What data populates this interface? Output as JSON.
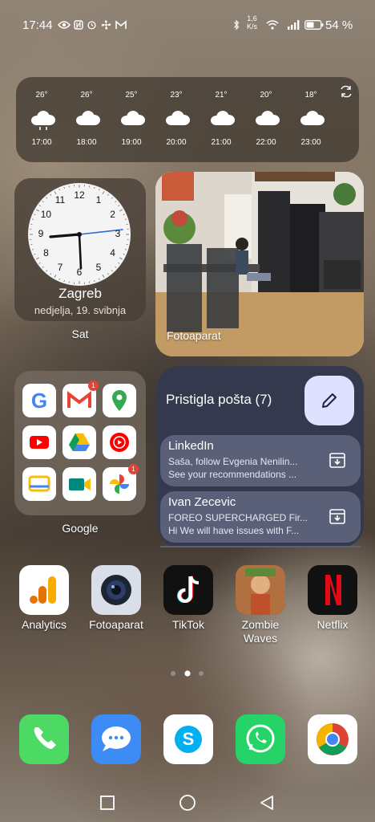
{
  "status": {
    "time": "17:44",
    "net_speed_top": "1,6",
    "net_speed_unit": "K/s",
    "battery": "54 %"
  },
  "weather": {
    "items": [
      {
        "temp": "26°",
        "hour": "17:00",
        "icon": "cloud-rain-icon"
      },
      {
        "temp": "26°",
        "hour": "18:00",
        "icon": "cloud-icon"
      },
      {
        "temp": "25°",
        "hour": "19:00",
        "icon": "cloud-icon"
      },
      {
        "temp": "23°",
        "hour": "20:00",
        "icon": "cloud-icon"
      },
      {
        "temp": "21°",
        "hour": "21:00",
        "icon": "cloud-icon"
      },
      {
        "temp": "20°",
        "hour": "22:00",
        "icon": "cloud-icon"
      },
      {
        "temp": "18°",
        "hour": "23:00",
        "icon": "cloud-icon"
      }
    ]
  },
  "clock": {
    "city": "Zagreb",
    "date": "nedjelja, 19. svibnja",
    "label": "Sat",
    "numbers": [
      "12",
      "1",
      "2",
      "3",
      "4",
      "5",
      "6",
      "7",
      "8",
      "9",
      "10",
      "11"
    ]
  },
  "photo": {
    "label": "Fotoaparat"
  },
  "google_folder": {
    "label": "Google",
    "apps": [
      {
        "name": "Google",
        "icon": "google-icon"
      },
      {
        "name": "Gmail",
        "icon": "gmail-icon",
        "badge": "1"
      },
      {
        "name": "Maps",
        "icon": "maps-icon"
      },
      {
        "name": "YouTube",
        "icon": "youtube-icon"
      },
      {
        "name": "Drive",
        "icon": "drive-icon"
      },
      {
        "name": "YT Music",
        "icon": "youtube-music-icon"
      },
      {
        "name": "Google TV",
        "icon": "google-tv-icon"
      },
      {
        "name": "Meet",
        "icon": "meet-icon"
      },
      {
        "name": "Photos",
        "icon": "photos-icon",
        "badge": "1"
      }
    ]
  },
  "mail": {
    "title": "Pristigla pošta (7)",
    "items": [
      {
        "from": "LinkedIn",
        "line1": "Saša, follow Evgenia Nenilin...",
        "line2": "See your recommendations ..."
      },
      {
        "from": "Ivan Zecevic",
        "line1": "FOREO SUPERCHARGED Fir...",
        "line2": "Hi We will have issues with F..."
      }
    ]
  },
  "apps": [
    {
      "name": "Analytics",
      "icon": "analytics-icon"
    },
    {
      "name": "Fotoaparat",
      "icon": "camera-icon"
    },
    {
      "name": "TikTok",
      "icon": "tiktok-icon"
    },
    {
      "name": "Zombie Waves",
      "icon": "zombie-waves-icon"
    },
    {
      "name": "Netflix",
      "icon": "netflix-icon"
    }
  ],
  "dock": [
    {
      "icon": "phone-icon"
    },
    {
      "icon": "messages-icon"
    },
    {
      "icon": "skype-icon"
    },
    {
      "icon": "whatsapp-icon"
    },
    {
      "icon": "chrome-icon"
    }
  ]
}
